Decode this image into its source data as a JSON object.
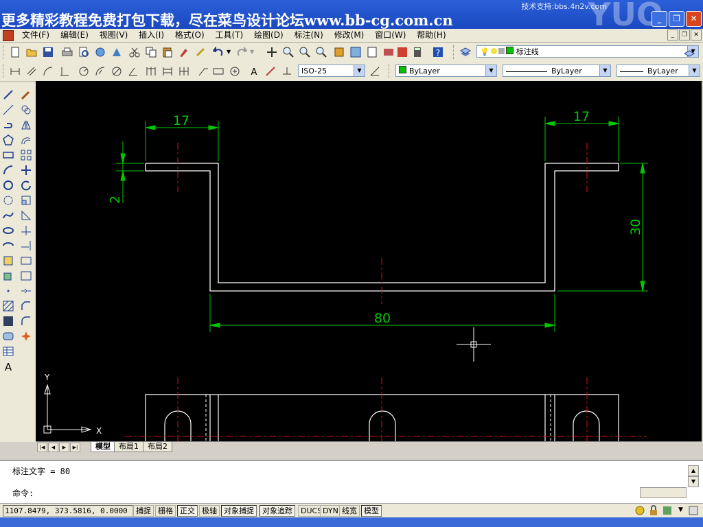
{
  "banner": {
    "text": "更多精彩教程免费打包下载，尽在菜鸟设计论坛www.bb-cg.com.cn",
    "tech_support": "技术支持:bbs.4n2v.com"
  },
  "menu": [
    "文件(F)",
    "编辑(E)",
    "视图(V)",
    "插入(I)",
    "格式(O)",
    "工具(T)",
    "绘图(D)",
    "标注(N)",
    "修改(M)",
    "窗口(W)",
    "帮助(H)"
  ],
  "toolbar": {
    "layer_name": "标注线",
    "dim_style": "ISO-25",
    "color": "ByLayer",
    "linetype": "ByLayer",
    "lineweight": "ByLayer"
  },
  "drawing": {
    "dim_top_left": "17",
    "dim_top_right": "17",
    "dim_left_height": "2",
    "dim_right_height": "30",
    "dim_bottom": "80",
    "ucs_x": "X",
    "ucs_y": "Y"
  },
  "tabs": [
    "模型",
    "布局1",
    "布局2"
  ],
  "command": {
    "history": "标注文字 = 80",
    "prompt": "命令:"
  },
  "status": {
    "coords": "1107.8479, 373.5816, 0.0000",
    "buttons": [
      "捕捉",
      "栅格",
      "正交",
      "极轴",
      "对象捕捉",
      "对象追踪",
      "DUCS",
      "DYN",
      "线宽",
      "模型"
    ]
  },
  "colors": {
    "dim": "#00c800",
    "center": "#e01010",
    "geometry": "#ffffff"
  }
}
